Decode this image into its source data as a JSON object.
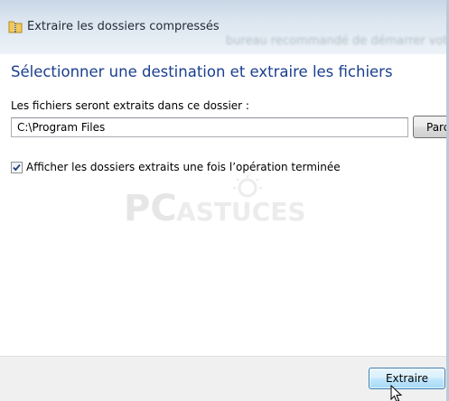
{
  "window": {
    "title": "Extraire les dossiers compressés",
    "background_text": "bureau recommandé de démarrer votre ordinateur. Fenêtrez ce mettra ave"
  },
  "content": {
    "heading": "Sélectionner une destination et extraire les fichiers",
    "destination_label": "Les fichiers seront extraits dans ce dossier :",
    "destination_path": "C:\\Program Files",
    "browse_label": "Parcourir...",
    "show_files_label": "Afficher les dossiers extraits une fois l’opération terminée",
    "show_files_checked": true
  },
  "watermark": {
    "brand_left": "PC",
    "brand_right": "ASTUCES"
  },
  "footer": {
    "extract_label": "Extraire"
  },
  "colors": {
    "heading": "#1a3e8f",
    "button_border_default": "#3c7fb1",
    "footer_bg": "#f0f0f0"
  },
  "icons": {
    "title": "zip-folder-icon",
    "checkbox": "checkmark-icon",
    "pointer": "mouse-cursor-icon"
  }
}
